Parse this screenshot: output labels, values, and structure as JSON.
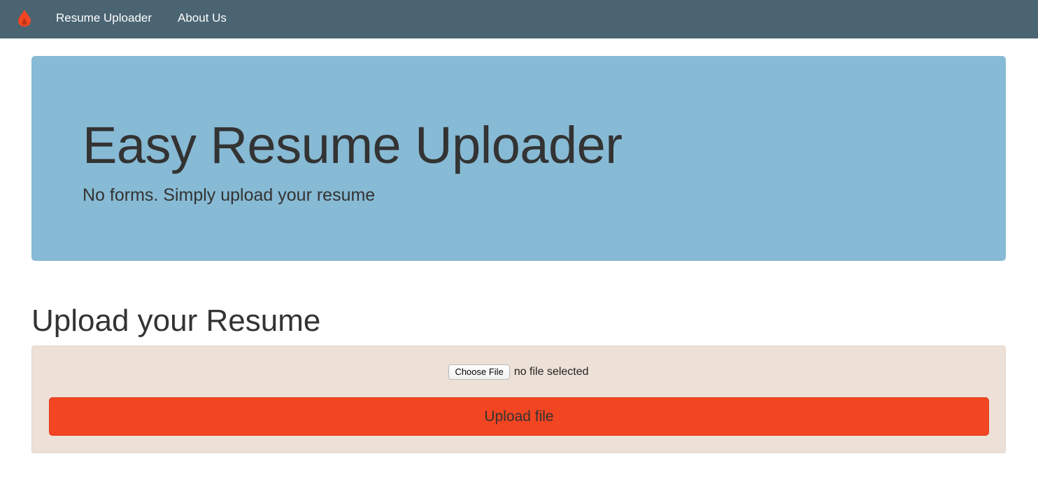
{
  "navbar": {
    "brand_icon": "flame-drop-icon",
    "brand_color": "#f24521",
    "background": "#4a6472",
    "links": [
      {
        "label": "Resume Uploader"
      },
      {
        "label": "About Us"
      }
    ]
  },
  "jumbotron": {
    "title": "Easy Resume Uploader",
    "subtitle": "No forms. Simply upload your resume",
    "background": "#87bad4"
  },
  "upload_section": {
    "heading": "Upload your Resume",
    "choose_file_label": "Choose File",
    "file_status": "no file selected",
    "upload_button_label": "Upload file",
    "upload_button_color": "#f24521",
    "well_background": "#ede0d6"
  }
}
